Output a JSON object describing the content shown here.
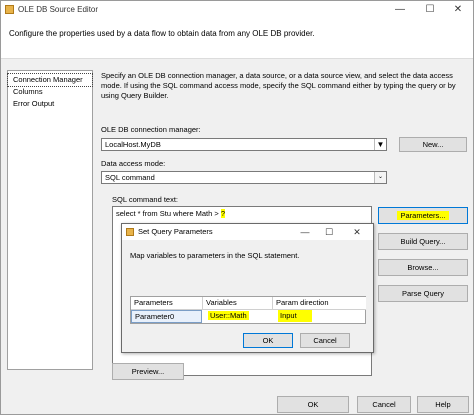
{
  "window": {
    "title": "OLE DB Source Editor",
    "minimize": "—",
    "maximize": "☐",
    "close": "✕"
  },
  "banner": {
    "text": "Configure the properties used by a data flow to obtain data from any OLE DB provider."
  },
  "nav": {
    "items": [
      {
        "label": "Connection Manager"
      },
      {
        "label": "Columns"
      },
      {
        "label": "Error Output"
      }
    ]
  },
  "main": {
    "description": "Specify an OLE DB connection manager, a data source, or a data source view, and select the data access mode. If using the SQL command access mode, specify the SQL command either by typing the query or by using Query Builder.",
    "connection_label": "OLE DB connection manager:",
    "connection_value": "LocalHost.MyDB",
    "new_button": "New...",
    "access_mode_label": "Data access mode:",
    "access_mode_value": "SQL command",
    "sql_label": "SQL command text:",
    "sql_text": "select * from Stu where Math > ",
    "sql_param": "?",
    "parameters_button": "Parameters...",
    "build_query_button": "Build Query...",
    "browse_button": "Browse...",
    "parse_query_button": "Parse Query",
    "preview_button": "Preview..."
  },
  "dialog": {
    "title": "Set Query Parameters",
    "minimize": "—",
    "maximize": "☐",
    "close": "✕",
    "description": "Map variables to parameters in the SQL statement.",
    "columns": [
      "Parameters",
      "Variables",
      "Param direction"
    ],
    "rows": [
      {
        "parameter": "Parameter0",
        "variable": "User::Math",
        "direction": "Input"
      }
    ],
    "ok_button": "OK",
    "cancel_button": "Cancel"
  },
  "footer": {
    "ok_button": "OK",
    "cancel_button": "Cancel",
    "help_button": "Help"
  },
  "colors": {
    "highlight": "#ffff00",
    "focus_border": "#0078d7"
  }
}
